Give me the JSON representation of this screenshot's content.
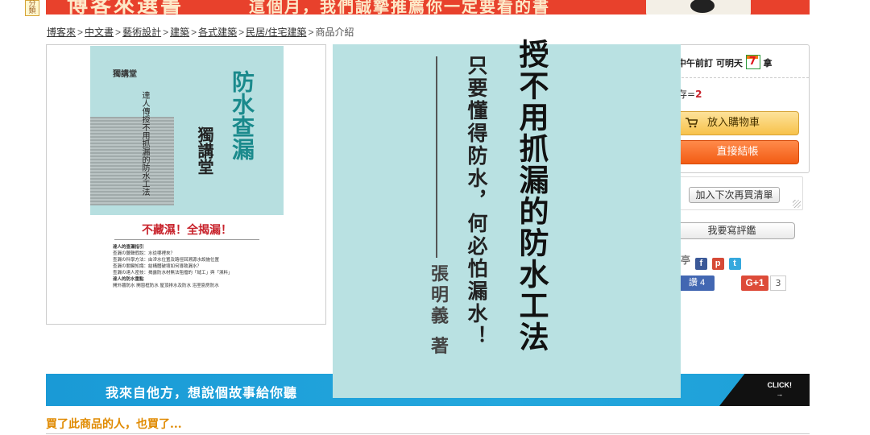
{
  "top_banner": {
    "category_tag": "分類",
    "headline": "博客來選書",
    "tagline": "這個月，我們誠摯推薦你一定要看的書"
  },
  "breadcrumb": {
    "items": [
      "博客來",
      "中文書",
      "藝術設計",
      "建築",
      "各式建築",
      "民居/住宅建築"
    ],
    "current": "商品介紹",
    "separator": ">"
  },
  "book_cover": {
    "publisher_logo": "獨講堂",
    "title": "防水查漏",
    "brand": "獨講堂",
    "subtitle": "達人傳授不用抓漏的防水工法",
    "slogan": "不藏濕！全揭漏！",
    "body_lines": [
      "達人的查漏指引",
      "查漏の聽聲假說：水從哪裡來？",
      "查漏の科學方法：由滲水位置及路徑回溯源水設施位置",
      "查漏の關鍵知識：結構體破壞如何導致漏水？",
      "查漏の達人密技：揭露防水材無法阻擋的「縫工」與「濕料」",
      "達人的防水重點",
      "開外牆防水 開窗框防水 屋頂排水及防水 浴室廚房防水"
    ]
  },
  "zoom_view": {
    "title_partial": "授不用抓漏的防水工法",
    "subtitle": "只要懂得防水，何必怕漏水！",
    "author": "張明義 著"
  },
  "purchase": {
    "delivery_text": "中午前訂 可明天",
    "delivery_suffix": "拿",
    "stock_label": "存=",
    "stock_value": "2",
    "add_to_cart": "放入購物車",
    "checkout": "直接結帳",
    "wishlist": "加入下次再買清單",
    "write_review": "我要寫評鑑",
    "share_label": "亭",
    "like_label": "讚 4",
    "gplus_label": "G+1",
    "gplus_count": "3"
  },
  "ad_banner": {
    "text": "我來自他方，想說個故事給你聽",
    "click": "CLICK!",
    "arrow": "→"
  },
  "section_title": "買了此商品的人，也買了...",
  "colors": {
    "accent_orange": "#f25c14",
    "cart_yellow": "#f7c24b",
    "cover_teal": "#b7dfe0",
    "section_title": "#e08a00",
    "ad_blue": "#1a9ad6"
  },
  "icons": {
    "cart": "shopping-cart-icon",
    "seven_eleven": "seven-eleven-logo",
    "facebook": "facebook-icon",
    "plurk": "plurk-icon",
    "twitter": "twitter-icon"
  }
}
